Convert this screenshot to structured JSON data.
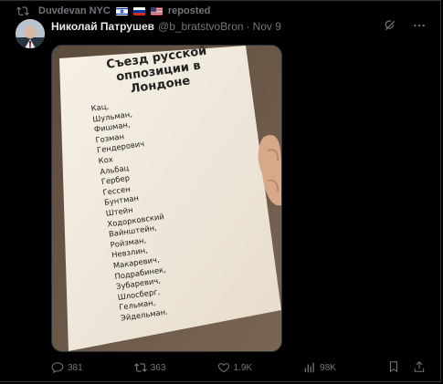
{
  "repost": {
    "user": "Duvdevan NYC",
    "label": "reposted"
  },
  "post": {
    "author_name": "Николай Патрушев",
    "author_handle": "@b_bratstvoBron",
    "separator": "·",
    "timestamp": "Nov 9"
  },
  "media": {
    "title_lines": [
      "Съезд русской",
      "оппозиции в Лондоне"
    ],
    "names": [
      "Кац,",
      "Шульман,",
      "Фишман,",
      "Гозман",
      "Гендерович",
      "Кох",
      "Альбац",
      "Гербер",
      "Гессен",
      "Бунтман",
      "Штейн",
      "Ходорковский",
      "Вайнштейн,",
      "Ройзман,",
      "Невзлин,",
      "Макаревич,",
      "Подрабинек,",
      "Зубаревич,",
      "Шлосберг,",
      "Гельман,",
      "Эйдельман."
    ]
  },
  "stats": {
    "replies": "381",
    "reposts": "363",
    "likes": "1.9K",
    "views": "98K"
  },
  "icons": {
    "repost": "repost-icon",
    "grok": "grok-icon",
    "more": "more-icon",
    "reply": "reply-icon",
    "like": "heart-icon",
    "views": "views-icon",
    "bookmark": "bookmark-icon",
    "share": "share-icon"
  },
  "colors": {
    "background": "#000000",
    "text": "#e7e9ea",
    "muted": "#71767b",
    "border": "#2f3336"
  }
}
